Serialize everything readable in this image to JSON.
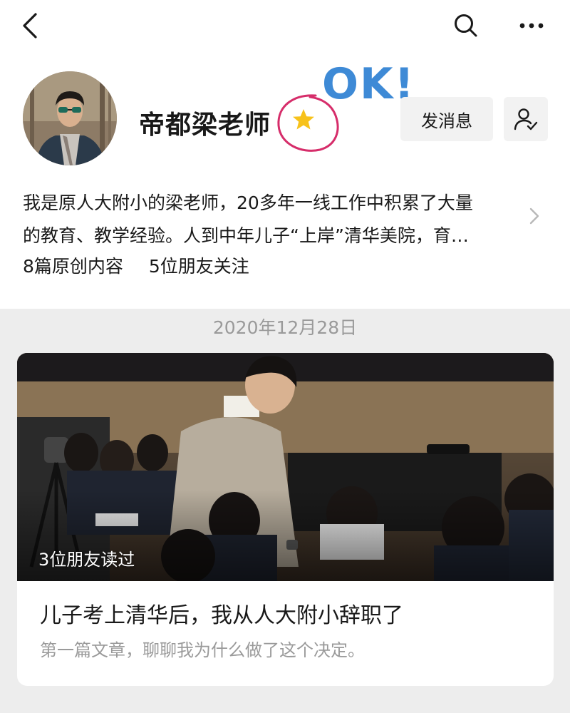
{
  "profile": {
    "name": "帝都梁老师",
    "sticker_text": "OK!",
    "message_button": "发消息",
    "bio_line1": "我是原人大附小的梁老师，20多年一线工作中积累了大量",
    "bio_line2": "的教育、教学经验。人到中年儿子“上岸”清华美院，育…",
    "stats": {
      "original_count": "8篇原创内容",
      "friends_following": "5位朋友关注"
    }
  },
  "feed": {
    "date": "2020年12月28日",
    "article": {
      "readers": "3位朋友读过",
      "title": "儿子考上清华后，我从人大附小辞职了",
      "description": "第一篇文章，聊聊我为什么做了这个决定。"
    }
  },
  "icons": {
    "back": "chevron-left-icon",
    "search": "search-icon",
    "more": "more-dots-icon",
    "star": "star-icon",
    "follow": "user-check-icon",
    "bio_expand": "chevron-right-icon"
  },
  "colors": {
    "star": "#f7c21b",
    "annotation_circle": "#d62d6a",
    "sticker": "#3e8ad6",
    "muted_text": "#9a9a9a",
    "background": "#ededed"
  }
}
